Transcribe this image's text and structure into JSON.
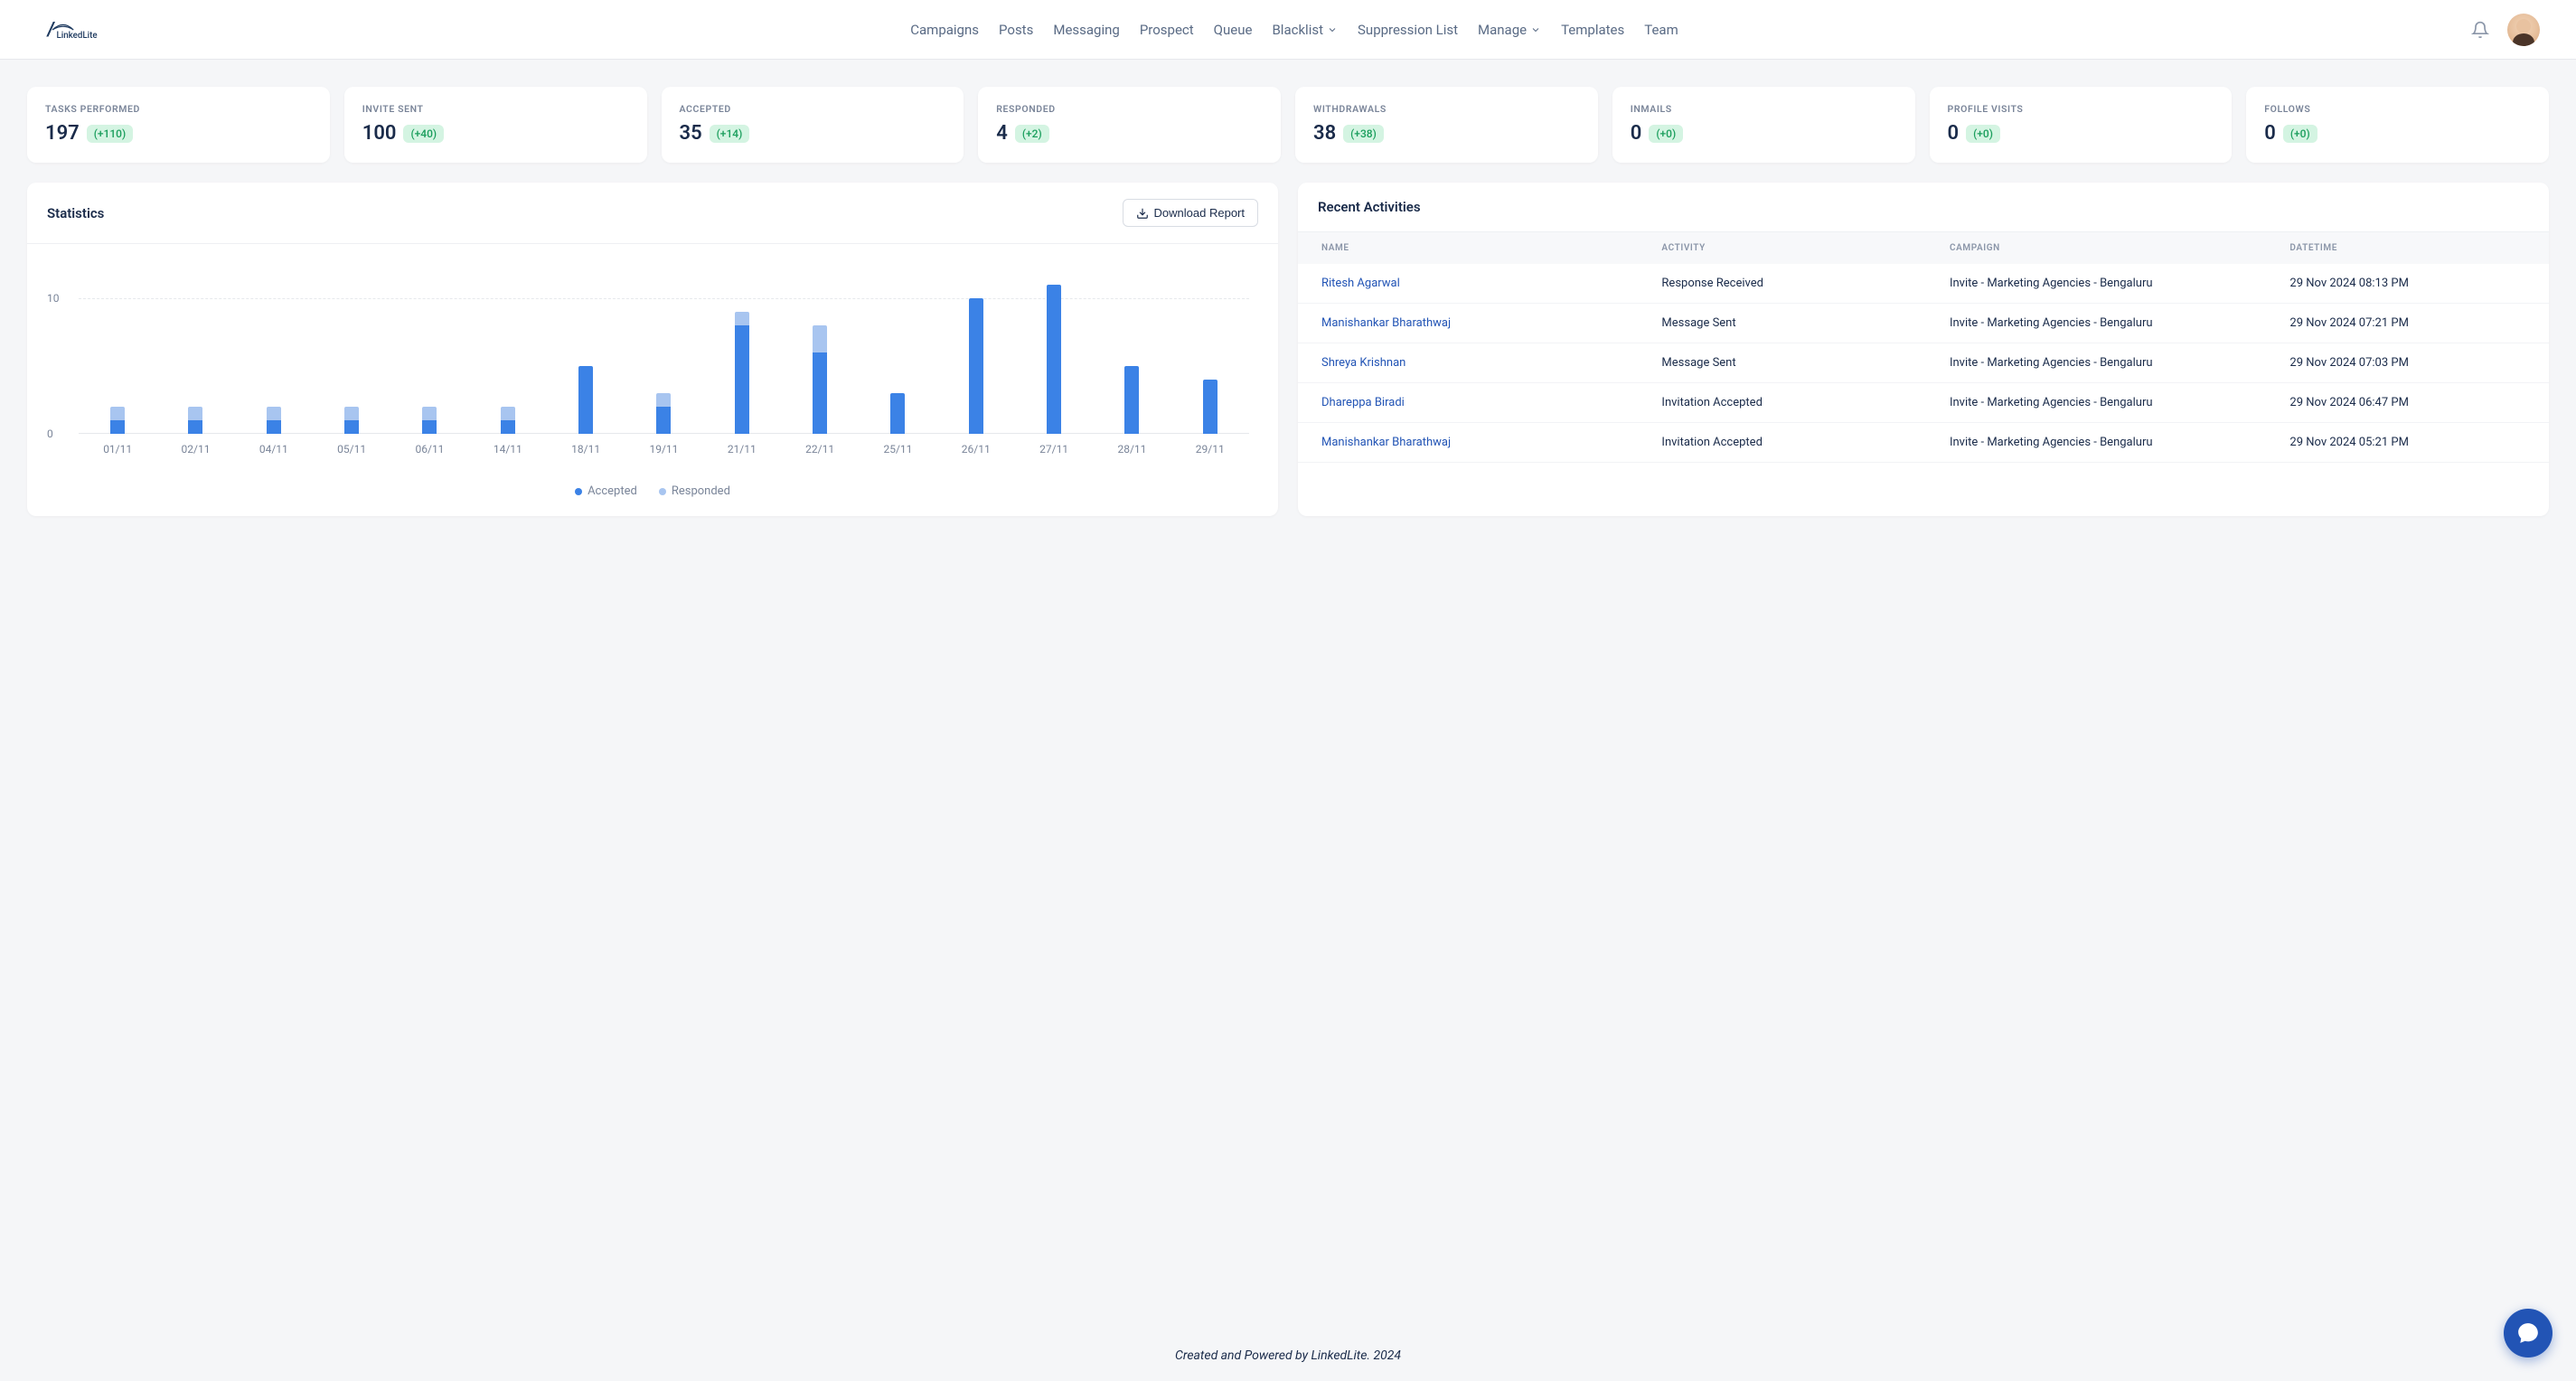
{
  "brand": "LinkedLite",
  "nav": {
    "items": [
      "Campaigns",
      "Posts",
      "Messaging",
      "Prospect",
      "Queue",
      "Blacklist",
      "Suppression List",
      "Manage",
      "Templates",
      "Team"
    ]
  },
  "stats": [
    {
      "label": "TASKS PERFORMED",
      "value": "197",
      "delta": "(+110)"
    },
    {
      "label": "INVITE SENT",
      "value": "100",
      "delta": "(+40)"
    },
    {
      "label": "ACCEPTED",
      "value": "35",
      "delta": "(+14)"
    },
    {
      "label": "RESPONDED",
      "value": "4",
      "delta": "(+2)"
    },
    {
      "label": "WITHDRAWALS",
      "value": "38",
      "delta": "(+38)"
    },
    {
      "label": "INMAILS",
      "value": "0",
      "delta": "(+0)"
    },
    {
      "label": "PROFILE VISITS",
      "value": "0",
      "delta": "(+0)"
    },
    {
      "label": "FOLLOWS",
      "value": "0",
      "delta": "(+0)"
    }
  ],
  "statistics_panel": {
    "title": "Statistics",
    "download_label": "Download Report",
    "legend_accepted": "Accepted",
    "legend_responded": "Responded",
    "y_ticks": [
      "0",
      "10"
    ]
  },
  "chart_data": {
    "type": "bar",
    "categories": [
      "01/11",
      "02/11",
      "04/11",
      "05/11",
      "06/11",
      "14/11",
      "18/11",
      "19/11",
      "21/11",
      "22/11",
      "25/11",
      "26/11",
      "27/11",
      "28/11",
      "29/11"
    ],
    "series": [
      {
        "name": "Accepted",
        "values": [
          1,
          1,
          1,
          1,
          1,
          1,
          5,
          2,
          8,
          6,
          3,
          10,
          11,
          5,
          4
        ]
      },
      {
        "name": "Responded",
        "values": [
          1,
          1,
          1,
          1,
          1,
          1,
          0,
          1,
          1,
          2,
          0,
          0,
          0,
          0,
          0
        ]
      }
    ],
    "ylim": [
      0,
      12
    ],
    "ylabel": "",
    "xlabel": ""
  },
  "activities_panel": {
    "title": "Recent Activities",
    "columns": [
      "NAME",
      "ACTIVITY",
      "CAMPAIGN",
      "DATETIME"
    ],
    "rows": [
      {
        "name": "Ritesh Agarwal",
        "activity": "Response Received",
        "campaign": "Invite - Marketing Agencies - Bengaluru",
        "datetime": "29 Nov 2024 08:13 PM"
      },
      {
        "name": "Manishankar Bharathwaj",
        "activity": "Message Sent",
        "campaign": "Invite - Marketing Agencies - Bengaluru",
        "datetime": "29 Nov 2024 07:21 PM"
      },
      {
        "name": "Shreya Krishnan",
        "activity": "Message Sent",
        "campaign": "Invite - Marketing Agencies - Bengaluru",
        "datetime": "29 Nov 2024 07:03 PM"
      },
      {
        "name": "Dhareppa Biradi",
        "activity": "Invitation Accepted",
        "campaign": "Invite - Marketing Agencies - Bengaluru",
        "datetime": "29 Nov 2024 06:47 PM"
      },
      {
        "name": "Manishankar Bharathwaj",
        "activity": "Invitation Accepted",
        "campaign": "Invite - Marketing Agencies - Bengaluru",
        "datetime": "29 Nov 2024 05:21 PM"
      }
    ]
  },
  "footer": "Created and Powered by LinkedLite. 2024"
}
